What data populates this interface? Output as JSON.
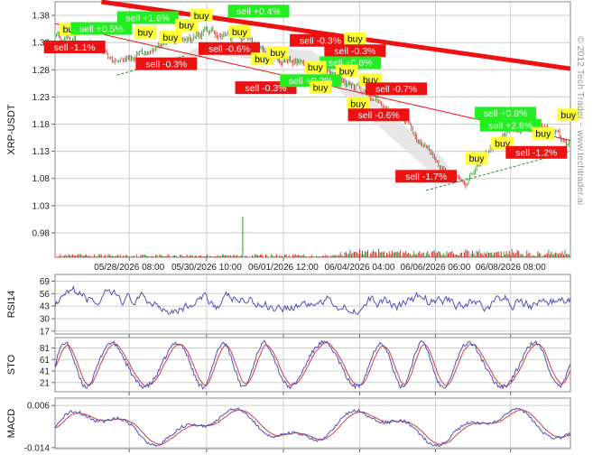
{
  "watermark": "© 2012 Tech Trader ~ www.techtrader.ai",
  "colors": {
    "up": "#2ca02c",
    "down": "#d62728",
    "buy_bg": "#ffff33",
    "sell_up_bg": "#22ee22",
    "sell_down_bg": "#ee1111",
    "indicator": "#5050c0",
    "signal": "#d04040",
    "trend_main": "#ee1111",
    "grid": "#cccccc"
  },
  "chart_data": [
    {
      "type": "candlestick",
      "name": "price",
      "ylabel": "XRP-USDT",
      "yticks": [
        1.38,
        1.33,
        1.28,
        1.23,
        1.18,
        1.13,
        1.08,
        1.03,
        0.98
      ],
      "ylim": [
        0.935,
        1.405
      ],
      "xlim": [
        0,
        100
      ],
      "xticks": [
        {
          "x": 14.4,
          "label": "05/28/2026 08:00"
        },
        {
          "x": 29.4,
          "label": "05/30/2026 10:00"
        },
        {
          "x": 44.3,
          "label": "06/01/2026 12:00"
        },
        {
          "x": 59.1,
          "label": "06/04/2026 04:00"
        },
        {
          "x": 73.8,
          "label": "06/06/2026 06:00"
        },
        {
          "x": 88.4,
          "label": "06/08/2026 08:00"
        }
      ],
      "anchors": [
        [
          0,
          1.345
        ],
        [
          3,
          1.335
        ],
        [
          6,
          1.325
        ],
        [
          9,
          1.31
        ],
        [
          12,
          1.295
        ],
        [
          15,
          1.305
        ],
        [
          18,
          1.32
        ],
        [
          21,
          1.33
        ],
        [
          24,
          1.335
        ],
        [
          27,
          1.345
        ],
        [
          30,
          1.35
        ],
        [
          33,
          1.345
        ],
        [
          36,
          1.34
        ],
        [
          39,
          1.32
        ],
        [
          42,
          1.31
        ],
        [
          45,
          1.3
        ],
        [
          48,
          1.29
        ],
        [
          51,
          1.28
        ],
        [
          54,
          1.27
        ],
        [
          57,
          1.255
        ],
        [
          60,
          1.24
        ],
        [
          63,
          1.22
        ],
        [
          66,
          1.2
        ],
        [
          69,
          1.175
        ],
        [
          72,
          1.14
        ],
        [
          75,
          1.1
        ],
        [
          78,
          1.08
        ],
        [
          80,
          1.075
        ],
        [
          82,
          1.1
        ],
        [
          84,
          1.13
        ],
        [
          86,
          1.15
        ],
        [
          88,
          1.165
        ],
        [
          90,
          1.17
        ],
        [
          92,
          1.175
        ],
        [
          94,
          1.18
        ],
        [
          96,
          1.17
        ],
        [
          98,
          1.155
        ],
        [
          100,
          1.145
        ]
      ],
      "volume_spikes": [
        [
          36.5,
          0.075
        ],
        [
          65,
          0.011
        ],
        [
          81,
          0.012
        ]
      ],
      "signals": [
        {
          "label": "buy",
          "kind": "buy",
          "x": 3.0,
          "y": 1.355
        },
        {
          "label": "sell -1.1%",
          "kind": "down",
          "x": 3.8,
          "y": 1.322
        },
        {
          "label": "sell +0.5%",
          "kind": "up",
          "x": 9.0,
          "y": 1.356
        },
        {
          "label": "sell +1.6%",
          "kind": "up",
          "x": 18.0,
          "y": 1.376
        },
        {
          "label": "buy",
          "kind": "buy",
          "x": 28.4,
          "y": 1.38
        },
        {
          "label": "sell +0.4%",
          "kind": "up",
          "x": 39.5,
          "y": 1.388
        },
        {
          "label": "buy",
          "kind": "buy",
          "x": 25.5,
          "y": 1.362
        },
        {
          "label": "buy",
          "kind": "buy",
          "x": 17.5,
          "y": 1.349
        },
        {
          "label": "buy",
          "kind": "buy",
          "x": 22.4,
          "y": 1.34
        },
        {
          "label": "sell -0.3%",
          "kind": "down",
          "x": 21.6,
          "y": 1.291
        },
        {
          "label": "buy",
          "kind": "buy",
          "x": 35.8,
          "y": 1.35
        },
        {
          "label": "sell -0.6%",
          "kind": "down",
          "x": 33.8,
          "y": 1.319
        },
        {
          "label": "buy",
          "kind": "buy",
          "x": 40.2,
          "y": 1.3
        },
        {
          "label": "sell -0.3%",
          "kind": "down",
          "x": 40.9,
          "y": 1.247
        },
        {
          "label": "buy",
          "kind": "buy",
          "x": 43.2,
          "y": 1.312
        },
        {
          "label": "sell -0.3%",
          "kind": "down",
          "x": 51.5,
          "y": 1.334
        },
        {
          "label": "buy",
          "kind": "buy",
          "x": 58.2,
          "y": 1.337
        },
        {
          "label": "sell -0.3%",
          "kind": "down",
          "x": 58.2,
          "y": 1.315
        },
        {
          "label": "sell +0.6%",
          "kind": "up",
          "x": 57.3,
          "y": 1.293
        },
        {
          "label": "buy",
          "kind": "buy",
          "x": 50.5,
          "y": 1.285
        },
        {
          "label": "buy",
          "kind": "buy",
          "x": 56.6,
          "y": 1.278
        },
        {
          "label": "sell +0.2%",
          "kind": "up",
          "x": 49.6,
          "y": 1.26
        },
        {
          "label": "buy",
          "kind": "buy",
          "x": 51.5,
          "y": 1.248
        },
        {
          "label": "buy",
          "kind": "buy",
          "x": 61.2,
          "y": 1.262
        },
        {
          "label": "sell -0.7%",
          "kind": "down",
          "x": 66.2,
          "y": 1.245
        },
        {
          "label": "buy",
          "kind": "buy",
          "x": 58.8,
          "y": 1.218
        },
        {
          "label": "sell -0.6%",
          "kind": "down",
          "x": 62.8,
          "y": 1.197
        },
        {
          "label": "sell -1.7%",
          "kind": "down",
          "x": 72.0,
          "y": 1.084
        },
        {
          "label": "buy",
          "kind": "buy",
          "x": 81.8,
          "y": 1.117
        },
        {
          "label": "buy",
          "kind": "buy",
          "x": 86.8,
          "y": 1.145
        },
        {
          "label": "sell +0.8%",
          "kind": "up",
          "x": 87.4,
          "y": 1.2
        },
        {
          "label": "sell +2.8%",
          "kind": "up",
          "x": 88.4,
          "y": 1.178
        },
        {
          "label": "buy",
          "kind": "buy",
          "x": 94.7,
          "y": 1.163
        },
        {
          "label": "sell -1.2%",
          "kind": "down",
          "x": 93.4,
          "y": 1.128
        },
        {
          "label": "buy",
          "kind": "buy",
          "x": 99.6,
          "y": 1.197
        }
      ]
    },
    {
      "type": "line",
      "name": "rsi",
      "ylabel": "RSI14",
      "yticks": [
        69,
        56,
        43,
        30,
        17
      ],
      "ylim": [
        14,
        76
      ]
    },
    {
      "type": "line",
      "name": "sto",
      "ylabel": "STO",
      "yticks": [
        81,
        61,
        41,
        21
      ],
      "ylim": [
        5,
        99
      ]
    },
    {
      "type": "line",
      "name": "macd",
      "ylabel": "MACD",
      "yticks": [
        0.006,
        -0.014
      ],
      "ytick_labels": [
        "0.006",
        "-0.014"
      ],
      "ylim": [
        -0.0145,
        0.0095
      ]
    }
  ]
}
